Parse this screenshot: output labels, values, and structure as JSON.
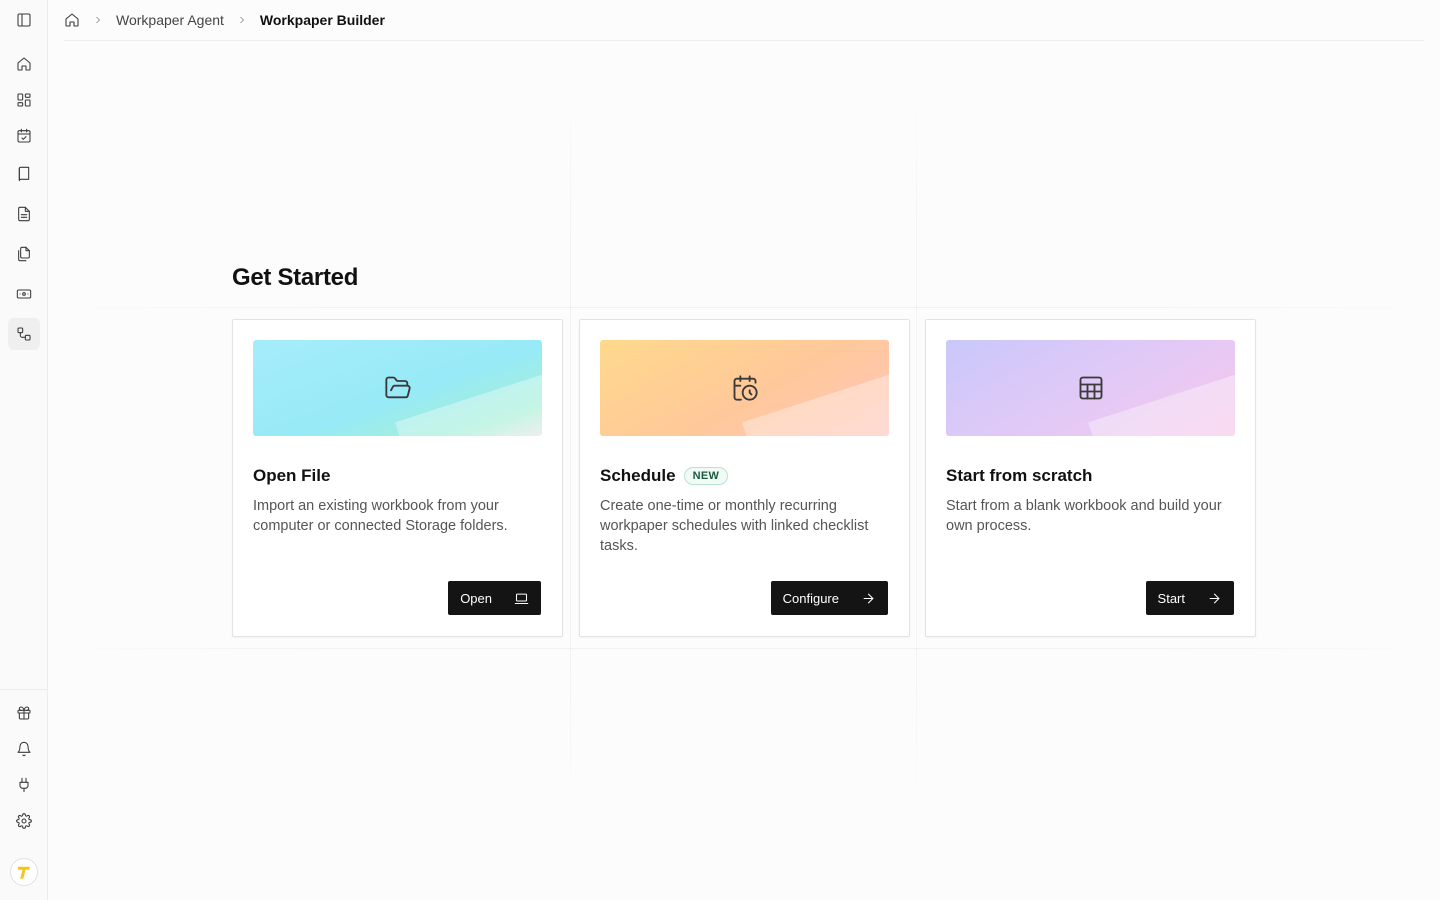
{
  "breadcrumb": {
    "home_icon": "home-icon",
    "items": [
      "Workpaper Agent",
      "Workpaper Builder"
    ]
  },
  "sidebar": {
    "top_icons": [
      "panel-left-icon",
      "home-icon",
      "grid-icon",
      "calendar-check-icon",
      "book-icon",
      "file-text-icon",
      "files-icon",
      "banknote-icon",
      "workflow-icon"
    ],
    "bottom_icons": [
      "gift-icon",
      "bell-icon",
      "plug-icon",
      "settings-icon"
    ],
    "active": "workflow-icon"
  },
  "main": {
    "heading": "Get Started",
    "cards": [
      {
        "title": "Open File",
        "description": "Import an existing workbook from your computer or connected Storage folders.",
        "button": "Open",
        "icon": "folder-open-icon",
        "button_icon": "laptop-icon"
      },
      {
        "title": "Schedule",
        "badge": "NEW",
        "description": "Create one-time or monthly recurring workpaper schedules with linked checklist tasks.",
        "button": "Configure",
        "icon": "calendar-clock-icon",
        "button_icon": "arrow-right-icon"
      },
      {
        "title": "Start from scratch",
        "description": "Start from a blank workbook and build your own process.",
        "button": "Start",
        "icon": "table-icon",
        "button_icon": "arrow-right-icon"
      }
    ]
  },
  "colors": {
    "button_bg": "#141414",
    "badge_border": "#b8e4d0",
    "avatar_accent": "#f5c518"
  }
}
